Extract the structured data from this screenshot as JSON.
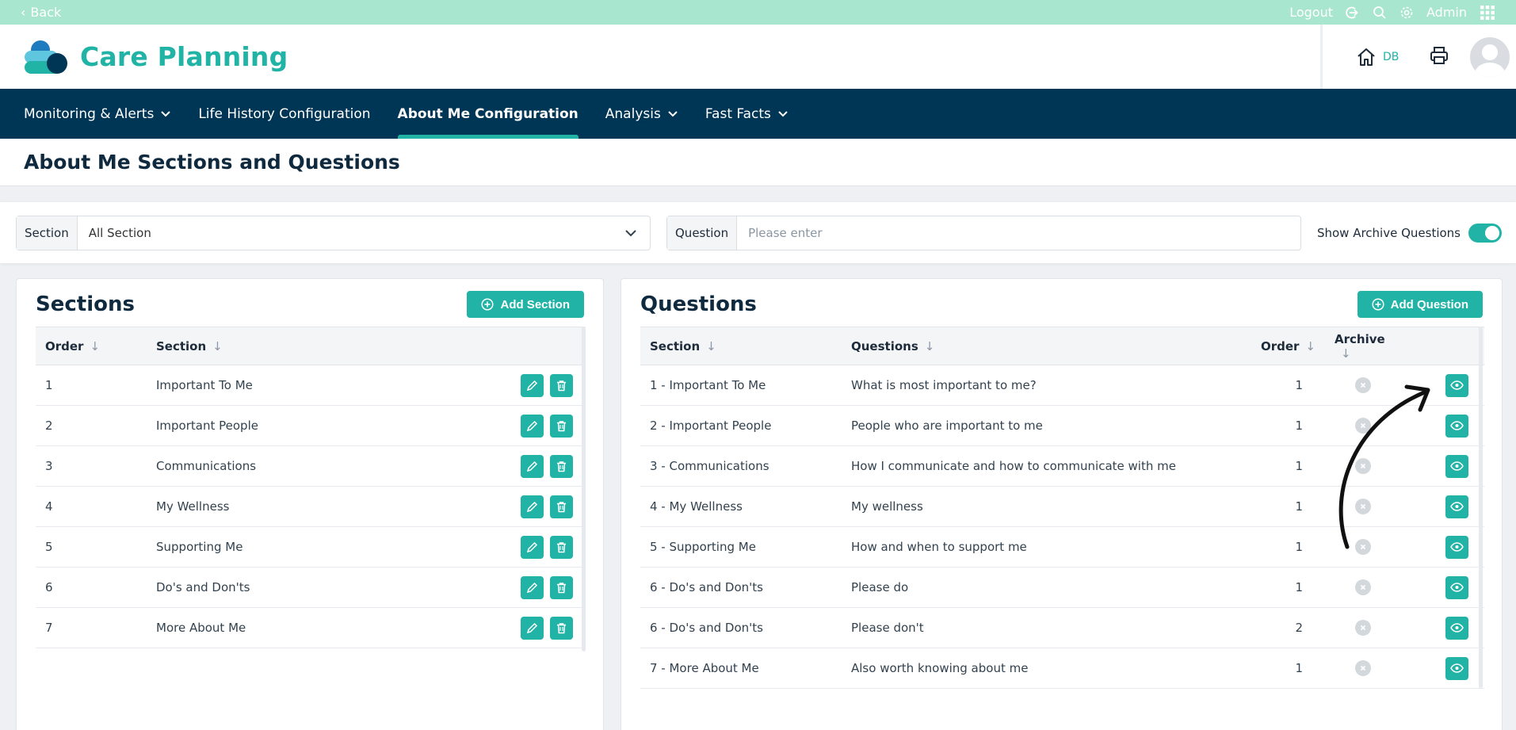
{
  "topbar": {
    "back_label": "Back",
    "logout_label": "Logout",
    "user_label": "Admin"
  },
  "header": {
    "app_title": "Care Planning",
    "db_label": "DB"
  },
  "nav": {
    "items": [
      {
        "label": "Monitoring & Alerts",
        "dropdown": true
      },
      {
        "label": "Life History Configuration",
        "dropdown": false
      },
      {
        "label": "About Me Configuration",
        "dropdown": false,
        "active": true
      },
      {
        "label": "Analysis",
        "dropdown": true
      },
      {
        "label": "Fast Facts",
        "dropdown": true
      }
    ]
  },
  "page": {
    "title": "About Me Sections and Questions"
  },
  "filters": {
    "section_label": "Section",
    "section_value": "All Section",
    "question_label": "Question",
    "question_placeholder": "Please enter",
    "question_value": "",
    "archive_toggle_label": "Show Archive Questions",
    "archive_toggle_on": true
  },
  "sections_panel": {
    "title": "Sections",
    "add_button": "Add Section",
    "columns": [
      "Order",
      "Section"
    ],
    "rows": [
      {
        "order": "1",
        "section": "Important To Me"
      },
      {
        "order": "2",
        "section": "Important People"
      },
      {
        "order": "3",
        "section": "Communications"
      },
      {
        "order": "4",
        "section": "My Wellness"
      },
      {
        "order": "5",
        "section": "Supporting Me"
      },
      {
        "order": "6",
        "section": "Do's and Don'ts"
      },
      {
        "order": "7",
        "section": "More About Me"
      }
    ]
  },
  "questions_panel": {
    "title": "Questions",
    "add_button": "Add Question",
    "columns": [
      "Section",
      "Questions",
      "Order",
      "Archive"
    ],
    "rows": [
      {
        "section": "1 - Important To Me",
        "question": "What is most important to me?",
        "order": "1"
      },
      {
        "section": "2 - Important People",
        "question": "People who are important to me",
        "order": "1"
      },
      {
        "section": "3 - Communications",
        "question": "How I communicate and how to communicate with me",
        "order": "1"
      },
      {
        "section": "4 - My Wellness",
        "question": "My wellness",
        "order": "1"
      },
      {
        "section": "5 - Supporting Me",
        "question": "How and when to support me",
        "order": "1"
      },
      {
        "section": "6 - Do's and Don'ts",
        "question": "Please do",
        "order": "1"
      },
      {
        "section": "6 - Do's and Don'ts",
        "question": "Please don't",
        "order": "2"
      },
      {
        "section": "7 - More About Me",
        "question": "Also worth knowing about me",
        "order": "1"
      }
    ]
  },
  "colors": {
    "accent": "#21b3a6",
    "nav_bg": "#003655",
    "topbar_bg": "#a8e6cf"
  },
  "icons": [
    "home-icon",
    "printer-icon",
    "avatar",
    "logout-icon",
    "search-icon",
    "gear-icon",
    "apps-grid-icon",
    "edit-icon",
    "trash-icon",
    "archive-x-icon",
    "eye-icon",
    "plus-circle-icon",
    "chevron-down-icon",
    "sort-arrow-icon"
  ]
}
